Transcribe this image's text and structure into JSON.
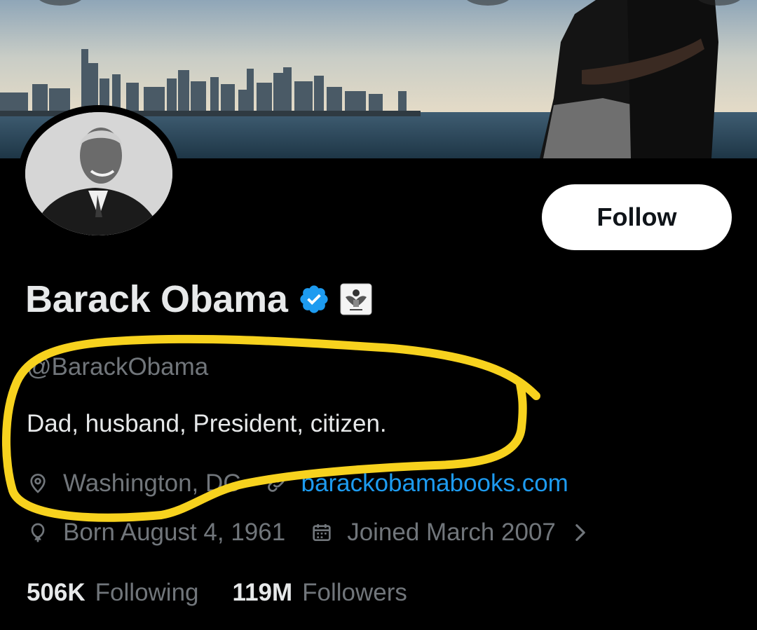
{
  "profile": {
    "name": "Barack Obama",
    "handle": "@BarackObama",
    "bio": "Dad, husband, President, citizen.",
    "location": "Washington, DC",
    "website": "barackobamabooks.com",
    "birthday": "Born August 4, 1961",
    "joined": "Joined March 2007"
  },
  "actions": {
    "follow_label": "Follow"
  },
  "stats": {
    "following_count": "506K",
    "following_label": "Following",
    "followers_count": "119M",
    "followers_label": "Followers"
  },
  "icons": {
    "verified": "verified-badge-icon",
    "affiliation": "presidential-seal-icon",
    "location": "location-pin-icon",
    "website": "link-icon",
    "birthday": "balloon-icon",
    "joined": "calendar-icon",
    "more": "chevron-right-icon"
  },
  "colors": {
    "background": "#000000",
    "primary_text": "#e7e9ea",
    "secondary_text": "#71767b",
    "link": "#1d9bf0",
    "verified": "#1d9bf0",
    "follow_button_bg": "#ffffff",
    "annotation_highlight": "#f7d21e"
  }
}
